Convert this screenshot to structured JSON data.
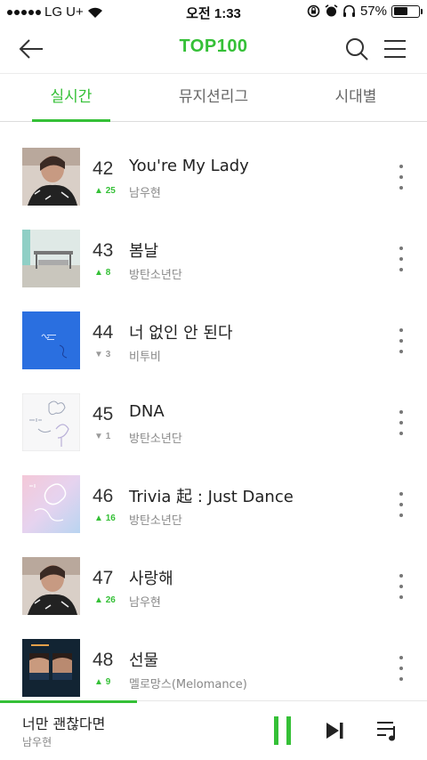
{
  "status_bar": {
    "carrier": "LG U+",
    "time": "오전 1:33",
    "battery": "57%",
    "battery_level": 0.57
  },
  "header": {
    "title": "TOP100"
  },
  "tabs": [
    {
      "label": "실시간",
      "active": true
    },
    {
      "label": "뮤지션리그",
      "active": false
    },
    {
      "label": "시대별",
      "active": false
    }
  ],
  "songs": [
    {
      "rank": "42",
      "change": "25",
      "direction": "up",
      "title": "You're My Lady",
      "artist": "남우현"
    },
    {
      "rank": "43",
      "change": "8",
      "direction": "up",
      "title": "봄날",
      "artist": "방탄소년단"
    },
    {
      "rank": "44",
      "change": "3",
      "direction": "down",
      "title": "너 없인 안 된다",
      "artist": "비투비"
    },
    {
      "rank": "45",
      "change": "1",
      "direction": "down",
      "title": "DNA",
      "artist": "방탄소년단"
    },
    {
      "rank": "46",
      "change": "16",
      "direction": "up",
      "title": "Trivia 起 : Just Dance",
      "artist": "방탄소년단"
    },
    {
      "rank": "47",
      "change": "26",
      "direction": "up",
      "title": "사랑해",
      "artist": "남우현"
    },
    {
      "rank": "48",
      "change": "9",
      "direction": "up",
      "title": "선물",
      "artist": "멜로망스(Melomance)"
    }
  ],
  "player": {
    "title": "너만 괜찮다면",
    "artist": "남우현",
    "progress": 0.32
  },
  "colors": {
    "accent": "#35c037"
  }
}
